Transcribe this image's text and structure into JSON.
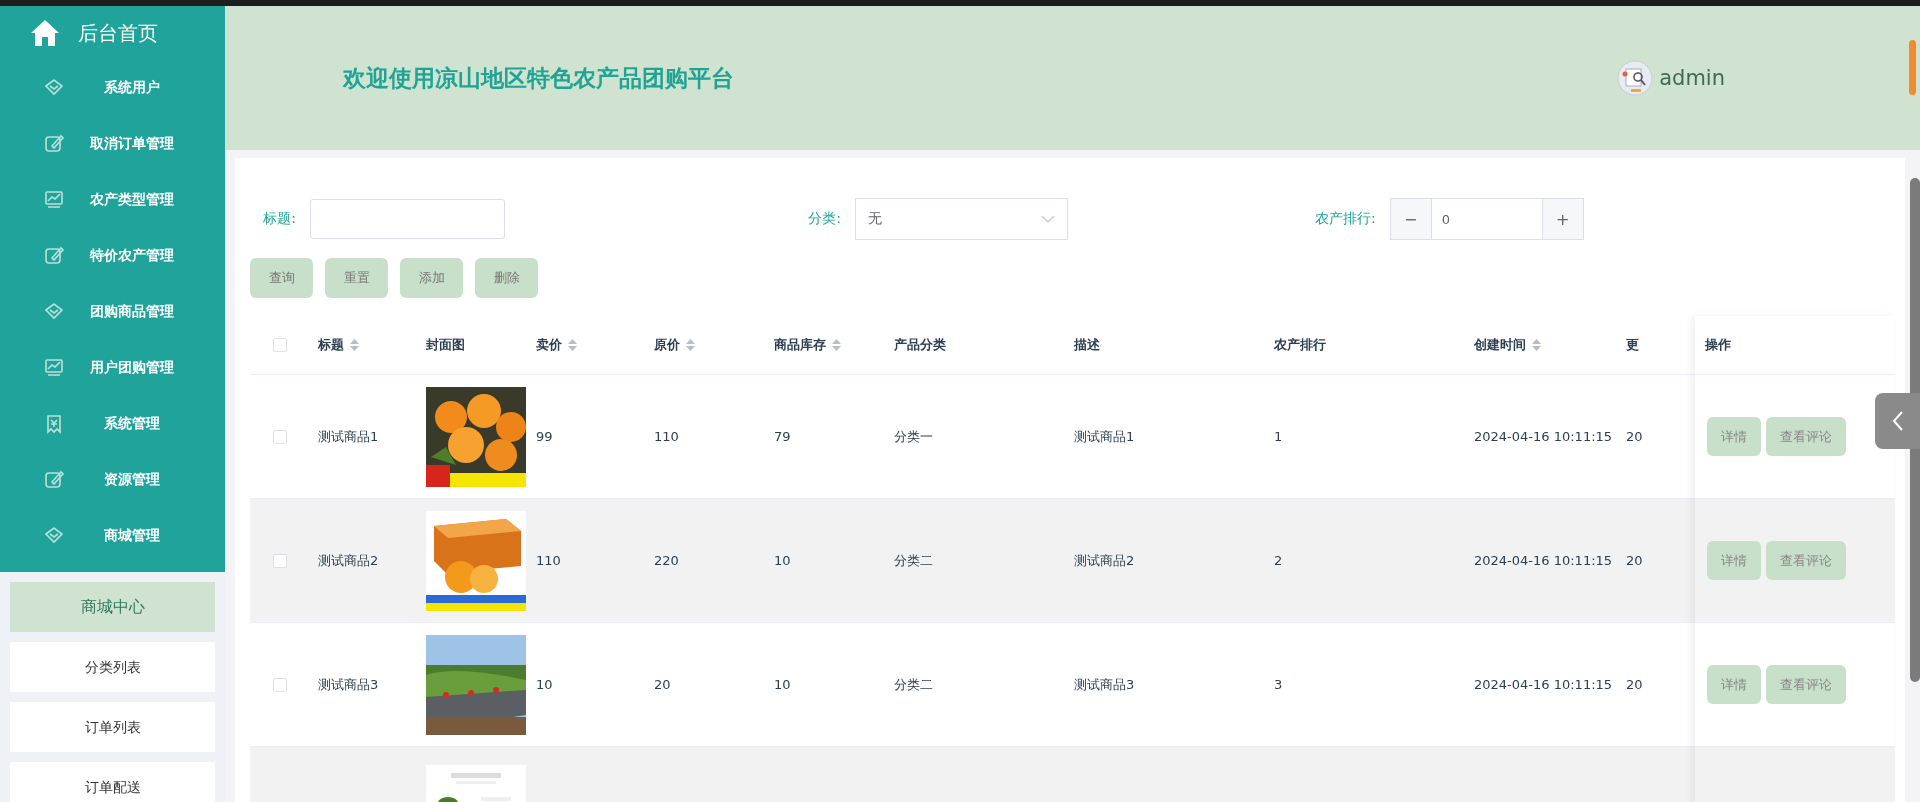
{
  "sidebar": {
    "home": {
      "label": "后台首页"
    },
    "menu": [
      {
        "label": "系统用户",
        "kind": "diamond"
      },
      {
        "label": "取消订单管理",
        "kind": "edit"
      },
      {
        "label": "农产类型管理",
        "kind": "chart"
      },
      {
        "label": "特价农产管理",
        "kind": "edit"
      },
      {
        "label": "团购商品管理",
        "kind": "diamond"
      },
      {
        "label": "用户团购管理",
        "kind": "chart"
      },
      {
        "label": "系统管理",
        "kind": "receipt"
      },
      {
        "label": "资源管理",
        "kind": "edit"
      },
      {
        "label": "商城管理",
        "kind": "diamond"
      }
    ],
    "submenu": [
      {
        "label": "商城中心",
        "selected": true
      },
      {
        "label": "分类列表",
        "selected": false
      },
      {
        "label": "订单列表",
        "selected": false
      },
      {
        "label": "订单配送",
        "selected": false
      }
    ]
  },
  "header": {
    "title": "欢迎使用凉山地区特色农产品团购平台",
    "user": "admin"
  },
  "filters": {
    "title_label": "标题:",
    "category_label": "分类:",
    "category_value": "无",
    "rank_label": "农产排行:",
    "rank_minus": "−",
    "rank_value": "0",
    "rank_plus": "+"
  },
  "actions": [
    "查询",
    "重置",
    "添加",
    "删除"
  ],
  "table": {
    "header_checked": false,
    "columns": [
      {
        "label": "标题",
        "sortable": true
      },
      {
        "label": "封面图",
        "sortable": false
      },
      {
        "label": "卖价",
        "sortable": true
      },
      {
        "label": "原价",
        "sortable": true
      },
      {
        "label": "商品库存",
        "sortable": true
      },
      {
        "label": "产品分类",
        "sortable": false
      },
      {
        "label": "描述",
        "sortable": false
      },
      {
        "label": "农产排行",
        "sortable": false
      },
      {
        "label": "创建时间",
        "sortable": true
      },
      {
        "label": "更",
        "sortable": false
      }
    ],
    "action_column": "操作",
    "rows": [
      {
        "checked": false,
        "cells": [
          "测试商品1",
          "",
          "99",
          "110",
          "79",
          "分类一",
          "测试商品1",
          "1",
          "2024-04-16 10:11:15",
          "20"
        ],
        "cover": {
          "kind": "picture"
        },
        "buttons": [
          "详情",
          "查看评论"
        ]
      },
      {
        "checked": false,
        "cells": [
          "测试商品2",
          "",
          "110",
          "220",
          "10",
          "分类二",
          "测试商品2",
          "2",
          "2024-04-16 10:11:15",
          "20"
        ],
        "cover": {
          "kind": "picture"
        },
        "buttons": [
          "详情",
          "查看评论"
        ]
      },
      {
        "checked": false,
        "cells": [
          "测试商品3",
          "",
          "10",
          "20",
          "10",
          "分类二",
          "测试商品3",
          "3",
          "2024-04-16 10:11:15",
          "20"
        ],
        "cover": {
          "kind": "picture"
        },
        "buttons": [
          "详情",
          "查看评论"
        ]
      },
      {
        "cover": {
          "kind": "picture"
        }
      }
    ]
  }
}
